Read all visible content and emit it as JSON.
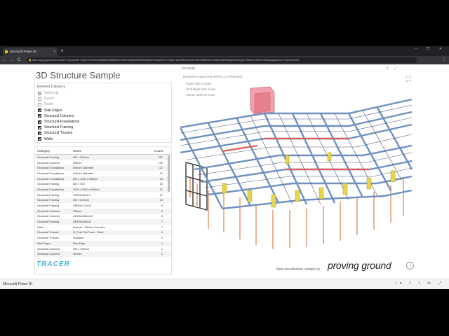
{
  "browser": {
    "tab_title": "Microsoft Power BI",
    "tab_close": "×",
    "new_tab": "+",
    "window_controls": "–  ❐  ✕",
    "back": "←",
    "forward": "→",
    "reload": "C",
    "lock": "🔒",
    "url": "https://app.powerbi.com/view?r=eyJrIjoiNDY0NjIxYWYtN2U2Mg05ZDMtNWEzZDItMTc3NjI4ZDRiLWI2MjJkZmIxNjZmYiLCJ0IjoiYzIxZWNhOGUtNTJhN2MtNDI1OC05NmJkMTAwZjNmOGQyNTBiIiwiYyI6NX0%3D&pageName=ReportSection",
    "menu": "⋮"
  },
  "report": {
    "title": "3D Structure Sample",
    "slicer": {
      "header": "Element Category",
      "items": [
        {
          "label": "Select all",
          "state": "half"
        },
        {
          "label": "Floors",
          "state": "off"
        },
        {
          "label": "Roofs",
          "state": "off"
        },
        {
          "label": "Slab Edges",
          "state": "on"
        },
        {
          "label": "Structural Columns",
          "state": "on"
        },
        {
          "label": "Structural Foundations",
          "state": "on"
        },
        {
          "label": "Structural Framing",
          "state": "on"
        },
        {
          "label": "Structural Trusses",
          "state": "on"
        },
        {
          "label": "Walls",
          "state": "on"
        }
      ]
    },
    "table": {
      "headers": {
        "category": "Category",
        "name": "Name",
        "count": "Count"
      },
      "rows": [
        {
          "category": "Structural Framing",
          "name": "800 x 800mm",
          "count": "387"
        },
        {
          "category": "Structural Columns",
          "name": "450mm",
          "count": "190"
        },
        {
          "category": "Structural Foundations",
          "name": "500mm Diameter",
          "count": "121"
        },
        {
          "category": "Structural Foundations",
          "name": "400mm Diameter",
          "count": "97"
        },
        {
          "category": "Structural Foundations",
          "name": "800 x 1500 x 900mm",
          "count": "49"
        },
        {
          "category": "Structural Framing",
          "name": "800 x 900",
          "count": "34"
        },
        {
          "category": "Structural Foundations",
          "name": "2000 x 2000 x 900mm",
          "count": "31"
        },
        {
          "category": "Structural Framing",
          "name": "HSS114.3X6.4",
          "count": "27"
        },
        {
          "category": "Structural Framing",
          "name": "300 x 600mm",
          "count": "19"
        },
        {
          "category": "Structural Framing",
          "name": "UB254x102x28",
          "count": "9"
        },
        {
          "category": "Structural Columns",
          "name": "750mm",
          "count": "8"
        },
        {
          "category": "Structural Columns",
          "name": "UC254x254x129",
          "count": "8"
        },
        {
          "category": "Structural Framing",
          "name": "UB305x165x40",
          "count": "7"
        },
        {
          "category": "Walls",
          "name": "Exterior - 300mm Concrete",
          "count": "7"
        },
        {
          "category": "Structural Trusses",
          "name": "M_Pratt Flat Truss - Short",
          "count": "3"
        },
        {
          "category": "Structural Trusses",
          "name": "Standard",
          "count": "2"
        },
        {
          "category": "Slab Edges",
          "name": "Slab Edge",
          "count": "1"
        },
        {
          "category": "Structural Columns",
          "name": "300 x 450mm",
          "count": "1"
        },
        {
          "category": "Structural Columns",
          "name": "300mm",
          "count": "1"
        }
      ]
    },
    "model": {
      "title": "3D Model",
      "subtitle": "Browsers supporting WebGL 2.0 Required",
      "hints": [
        "- Right-click to rotate",
        "- Shift-Right-click to pan",
        "- Mouse wheel to zoom"
      ],
      "toolbar_icons": "⊽ ⤢ ···",
      "expand_icon": "⛶"
    },
    "footer": {
      "logo": "TRACER",
      "attribution": "Data visualization sample by",
      "brand": "proving ground",
      "info": "i"
    },
    "colors": {
      "beam_blue": "#6e8fc0",
      "beam_red": "#e05a5a",
      "wall_pink": "#f2a0ad",
      "truss_yellow": "#e8d64a",
      "column_orange": "#e8a072",
      "accent": "#4fb3d9"
    }
  },
  "status": {
    "app": "Microsoft Power BI",
    "icons": "in  f  t  ✉  ⤢"
  }
}
